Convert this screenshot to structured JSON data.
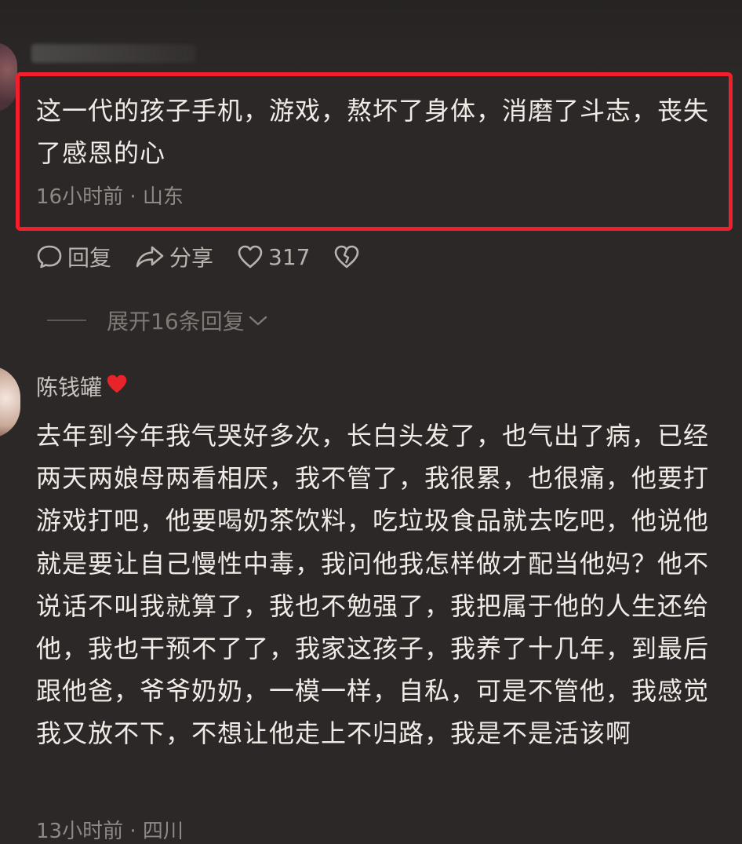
{
  "comment": {
    "text": "这一代的孩子手机，游戏，熬坏了身体，消磨了斗志，丧失了感恩的心",
    "meta": "16小时前 · 山东"
  },
  "actions": {
    "reply_label": "回复",
    "share_label": "分享",
    "like_count": "317"
  },
  "expand": {
    "label": "展开16条回复"
  },
  "reply": {
    "username": "陈钱罐",
    "user_icon": "red-heart",
    "text": "去年到今年我气哭好多次，长白头发了，也气出了病，已经两天两娘母两看相厌，我不管了，我很累，也很痛，他要打游戏打吧，他要喝奶茶饮料，吃垃圾食品就去吃吧，他说他就是要让自己慢性中毒，我问他我怎样做才配当他妈？他不说话不叫我就算了，我也不勉强了，我把属于他的人生还给他，我也干预不了了，我家这孩子，我养了十几年，到最后跟他爸，爷爷奶奶，一模一样，自私，可是不管他，我感觉我又放不下，不想让他走上不归路，我是不是活该啊",
    "meta": "13小时前 · 四川"
  },
  "colors": {
    "background": "#2b2827",
    "highlight": "#f11f2b",
    "heart": "#e8232a"
  }
}
